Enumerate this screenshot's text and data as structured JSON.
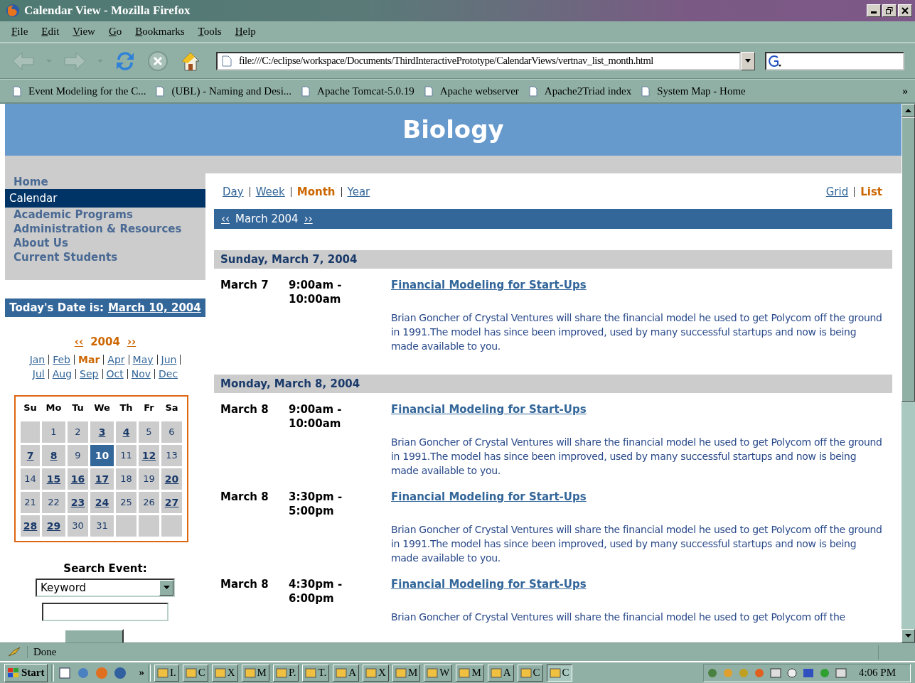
{
  "window": {
    "title": "Calendar View - Mozilla Firefox"
  },
  "menu": [
    "File",
    "Edit",
    "View",
    "Go",
    "Bookmarks",
    "Tools",
    "Help"
  ],
  "toolbar": {
    "address": "file:///C:/eclipse/workspace/Documents/ThirdInteractivePrototype/CalendarViews/vertnav_list_month.html"
  },
  "bookmarks": [
    "Event Modeling for the C...",
    "(UBL) - Naming and Desi...",
    "Apache Tomcat-5.0.19",
    "Apache webserver",
    "Apache2Triad index",
    "System Map - Home"
  ],
  "bookmarks_more": "»",
  "page": {
    "site_title": "Biology",
    "nav": [
      {
        "label": "Home",
        "selected": false
      },
      {
        "label": "Calendar",
        "selected": true
      },
      {
        "label": "Academic Programs",
        "selected": false
      },
      {
        "label": "Administration & Resources",
        "selected": false
      },
      {
        "label": "About Us",
        "selected": false
      },
      {
        "label": "Current Students",
        "selected": false
      }
    ],
    "today_label": "Today's Date is:",
    "today_link": "March 10, 2004",
    "year_nav": {
      "prev": "‹‹",
      "year": "2004",
      "next": "››"
    },
    "months": [
      {
        "label": "Jan",
        "selected": false
      },
      {
        "label": "Feb",
        "selected": false
      },
      {
        "label": "Mar",
        "selected": true
      },
      {
        "label": "Apr",
        "selected": false
      },
      {
        "label": "May",
        "selected": false
      },
      {
        "label": "Jun",
        "selected": false
      },
      {
        "label": "Jul",
        "selected": false
      },
      {
        "label": "Aug",
        "selected": false
      },
      {
        "label": "Sep",
        "selected": false
      },
      {
        "label": "Oct",
        "selected": false
      },
      {
        "label": "Nov",
        "selected": false
      },
      {
        "label": "Dec",
        "selected": false
      }
    ],
    "weekdays": [
      "Su",
      "Mo",
      "Tu",
      "We",
      "Th",
      "Fr",
      "Sa"
    ],
    "weeks": [
      [
        {
          "kind": "blank"
        },
        {
          "kind": "day",
          "day": "1",
          "events": false,
          "selected": false
        },
        {
          "kind": "day",
          "day": "2",
          "events": false,
          "selected": false
        },
        {
          "kind": "day",
          "day": "3",
          "events": true,
          "selected": false
        },
        {
          "kind": "day",
          "day": "4",
          "events": true,
          "selected": false
        },
        {
          "kind": "day",
          "day": "5",
          "events": false,
          "selected": false
        },
        {
          "kind": "day",
          "day": "6",
          "events": false,
          "selected": false
        }
      ],
      [
        {
          "kind": "day",
          "day": "7",
          "events": true,
          "selected": false
        },
        {
          "kind": "day",
          "day": "8",
          "events": true,
          "selected": false
        },
        {
          "kind": "day",
          "day": "9",
          "events": false,
          "selected": false
        },
        {
          "kind": "day",
          "day": "10",
          "events": false,
          "selected": true
        },
        {
          "kind": "day",
          "day": "11",
          "events": false,
          "selected": false
        },
        {
          "kind": "day",
          "day": "12",
          "events": true,
          "selected": false
        },
        {
          "kind": "day",
          "day": "13",
          "events": false,
          "selected": false
        }
      ],
      [
        {
          "kind": "day",
          "day": "14",
          "events": false,
          "selected": false
        },
        {
          "kind": "day",
          "day": "15",
          "events": true,
          "selected": false
        },
        {
          "kind": "day",
          "day": "16",
          "events": true,
          "selected": false
        },
        {
          "kind": "day",
          "day": "17",
          "events": true,
          "selected": false
        },
        {
          "kind": "day",
          "day": "18",
          "events": false,
          "selected": false
        },
        {
          "kind": "day",
          "day": "19",
          "events": false,
          "selected": false
        },
        {
          "kind": "day",
          "day": "20",
          "events": true,
          "selected": false
        }
      ],
      [
        {
          "kind": "day",
          "day": "21",
          "events": false,
          "selected": false
        },
        {
          "kind": "day",
          "day": "22",
          "events": false,
          "selected": false
        },
        {
          "kind": "day",
          "day": "23",
          "events": true,
          "selected": false
        },
        {
          "kind": "day",
          "day": "24",
          "events": true,
          "selected": false
        },
        {
          "kind": "day",
          "day": "25",
          "events": false,
          "selected": false
        },
        {
          "kind": "day",
          "day": "26",
          "events": false,
          "selected": false
        },
        {
          "kind": "day",
          "day": "27",
          "events": true,
          "selected": false
        }
      ],
      [
        {
          "kind": "day",
          "day": "28",
          "events": true,
          "selected": false
        },
        {
          "kind": "day",
          "day": "29",
          "events": true,
          "selected": false
        },
        {
          "kind": "day",
          "day": "30",
          "events": false,
          "selected": false
        },
        {
          "kind": "day",
          "day": "31",
          "events": false,
          "selected": false
        },
        {
          "kind": "blank"
        },
        {
          "kind": "blank"
        },
        {
          "kind": "blank"
        }
      ]
    ],
    "search": {
      "label": "Search Event:",
      "select_value": "Keyword"
    },
    "views": [
      {
        "label": "Day",
        "selected": false
      },
      {
        "label": "Week",
        "selected": false
      },
      {
        "label": "Month",
        "selected": true
      },
      {
        "label": "Year",
        "selected": false
      }
    ],
    "layouts": [
      {
        "label": "Grid",
        "selected": false
      },
      {
        "label": "List",
        "selected": true
      }
    ],
    "month_bar": {
      "prev": "‹‹",
      "title": "March 2004",
      "next": "››"
    },
    "days": [
      {
        "heading": "Sunday, March 7, 2004",
        "events": [
          {
            "date": "March 7",
            "start": "9:00am -",
            "end": "10:00am",
            "title": "Financial Modeling for Start-Ups",
            "description": "Brian Goncher of Crystal Ventures will share the financial model he used to get Polycom off the ground in 1991.The model has since been improved, used by many successful startups and now is being made available to you."
          }
        ]
      },
      {
        "heading": "Monday, March 8, 2004",
        "events": [
          {
            "date": "March 8",
            "start": "9:00am -",
            "end": "10:00am",
            "title": "Financial Modeling for Start-Ups",
            "description": "Brian Goncher of Crystal Ventures will share the financial model he used to get Polycom off the ground in 1991.The model has since been improved, used by many successful startups and now is being made available to you."
          },
          {
            "date": "March 8",
            "start": "3:30pm -",
            "end": "5:00pm",
            "title": "Financial Modeling for Start-Ups",
            "description": "Brian Goncher of Crystal Ventures will share the financial model he used to get Polycom off the ground in 1991.The model has since been improved, used by many successful startups and now is being made available to you."
          },
          {
            "date": "March 8",
            "start": "4:30pm -",
            "end": "6:00pm",
            "title": "Financial Modeling for Start-Ups",
            "description": "Brian Goncher of Crystal Ventures will share the financial model he used to get Polycom off the"
          }
        ]
      }
    ]
  },
  "status": "Done",
  "taskbar": {
    "start": "Start",
    "more": "»",
    "tasks": [
      {
        "label": "I.",
        "selected": false
      },
      {
        "label": "C",
        "selected": false
      },
      {
        "label": "X",
        "selected": false
      },
      {
        "label": "M",
        "selected": false
      },
      {
        "label": "P.",
        "selected": false
      },
      {
        "label": "T.",
        "selected": false
      },
      {
        "label": "A",
        "selected": false
      },
      {
        "label": "X",
        "selected": false
      },
      {
        "label": "M",
        "selected": false
      },
      {
        "label": "W",
        "selected": false
      },
      {
        "label": "M",
        "selected": false
      },
      {
        "label": "A",
        "selected": false
      },
      {
        "label": "C",
        "selected": false
      },
      {
        "label": "C",
        "selected": true
      }
    ],
    "clock": "4:06 PM"
  }
}
